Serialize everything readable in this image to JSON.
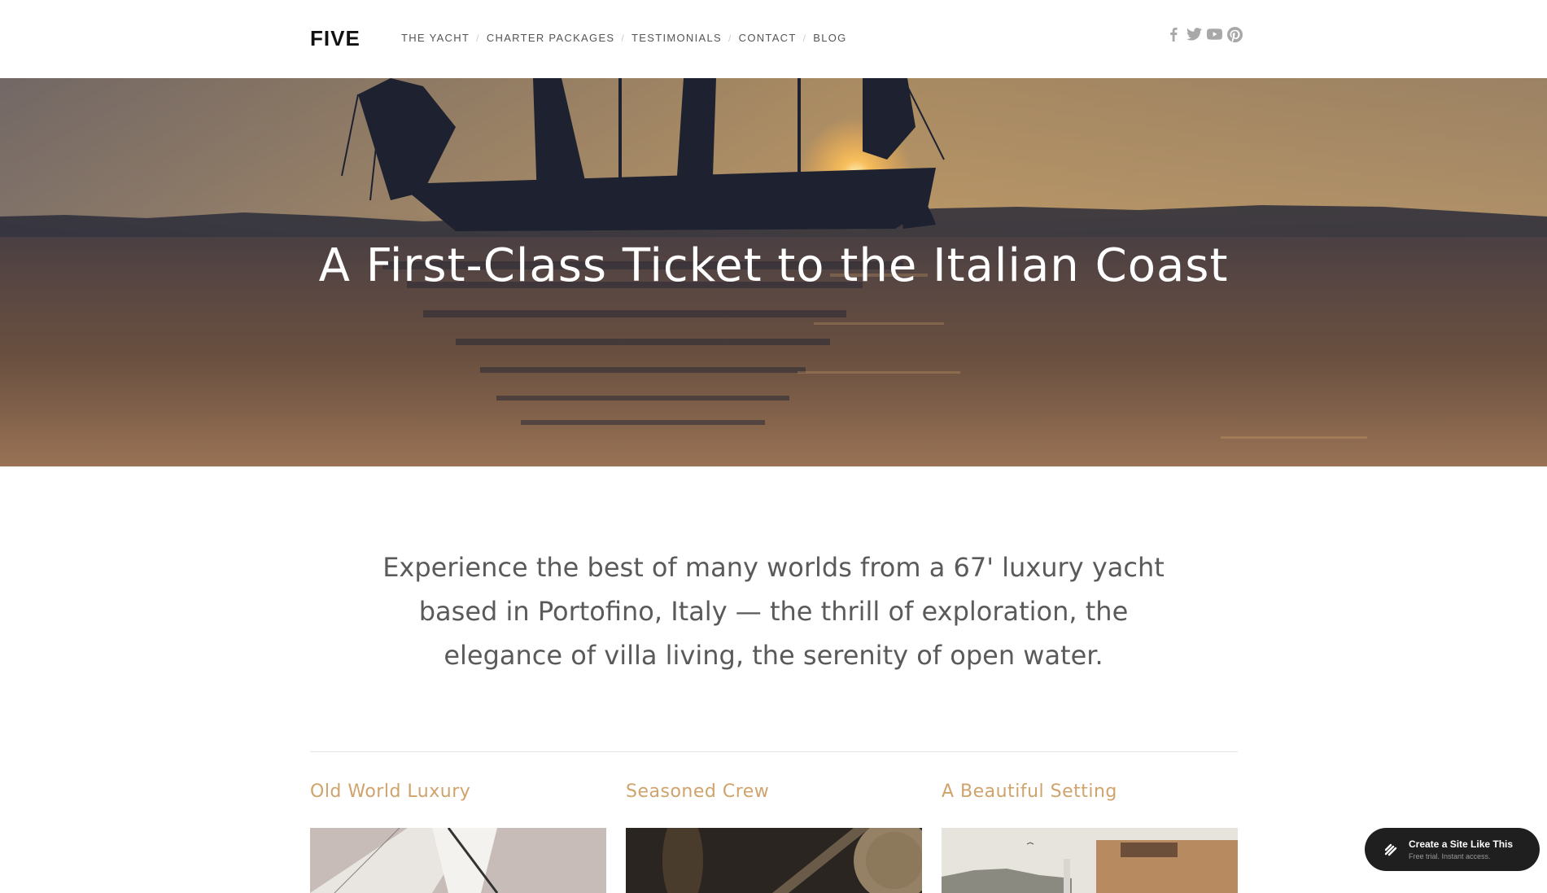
{
  "header": {
    "logo": "FIVE",
    "nav": [
      "THE YACHT",
      "CHARTER PACKAGES",
      "TESTIMONIALS",
      "CONTACT",
      "BLOG"
    ],
    "nav_separator": "/",
    "social_icons": [
      "facebook-icon",
      "twitter-icon",
      "youtube-icon",
      "pinterest-icon"
    ]
  },
  "hero": {
    "title": "A First-Class Ticket to the Italian Coast"
  },
  "intro": {
    "text": "Experience the best of many worlds from a 67' luxury yacht based in Portofino, Italy — the thrill of exploration, the elegance of villa living, the serenity of open water."
  },
  "features": [
    {
      "title": "Old World Luxury"
    },
    {
      "title": "Seasoned Crew"
    },
    {
      "title": "A Beautiful Setting"
    }
  ],
  "badge": {
    "title": "Create a Site Like This",
    "subtitle": "Free trial. Instant access."
  },
  "colors": {
    "accent": "#cfa36b",
    "badge_bg": "#1f1f1f"
  }
}
